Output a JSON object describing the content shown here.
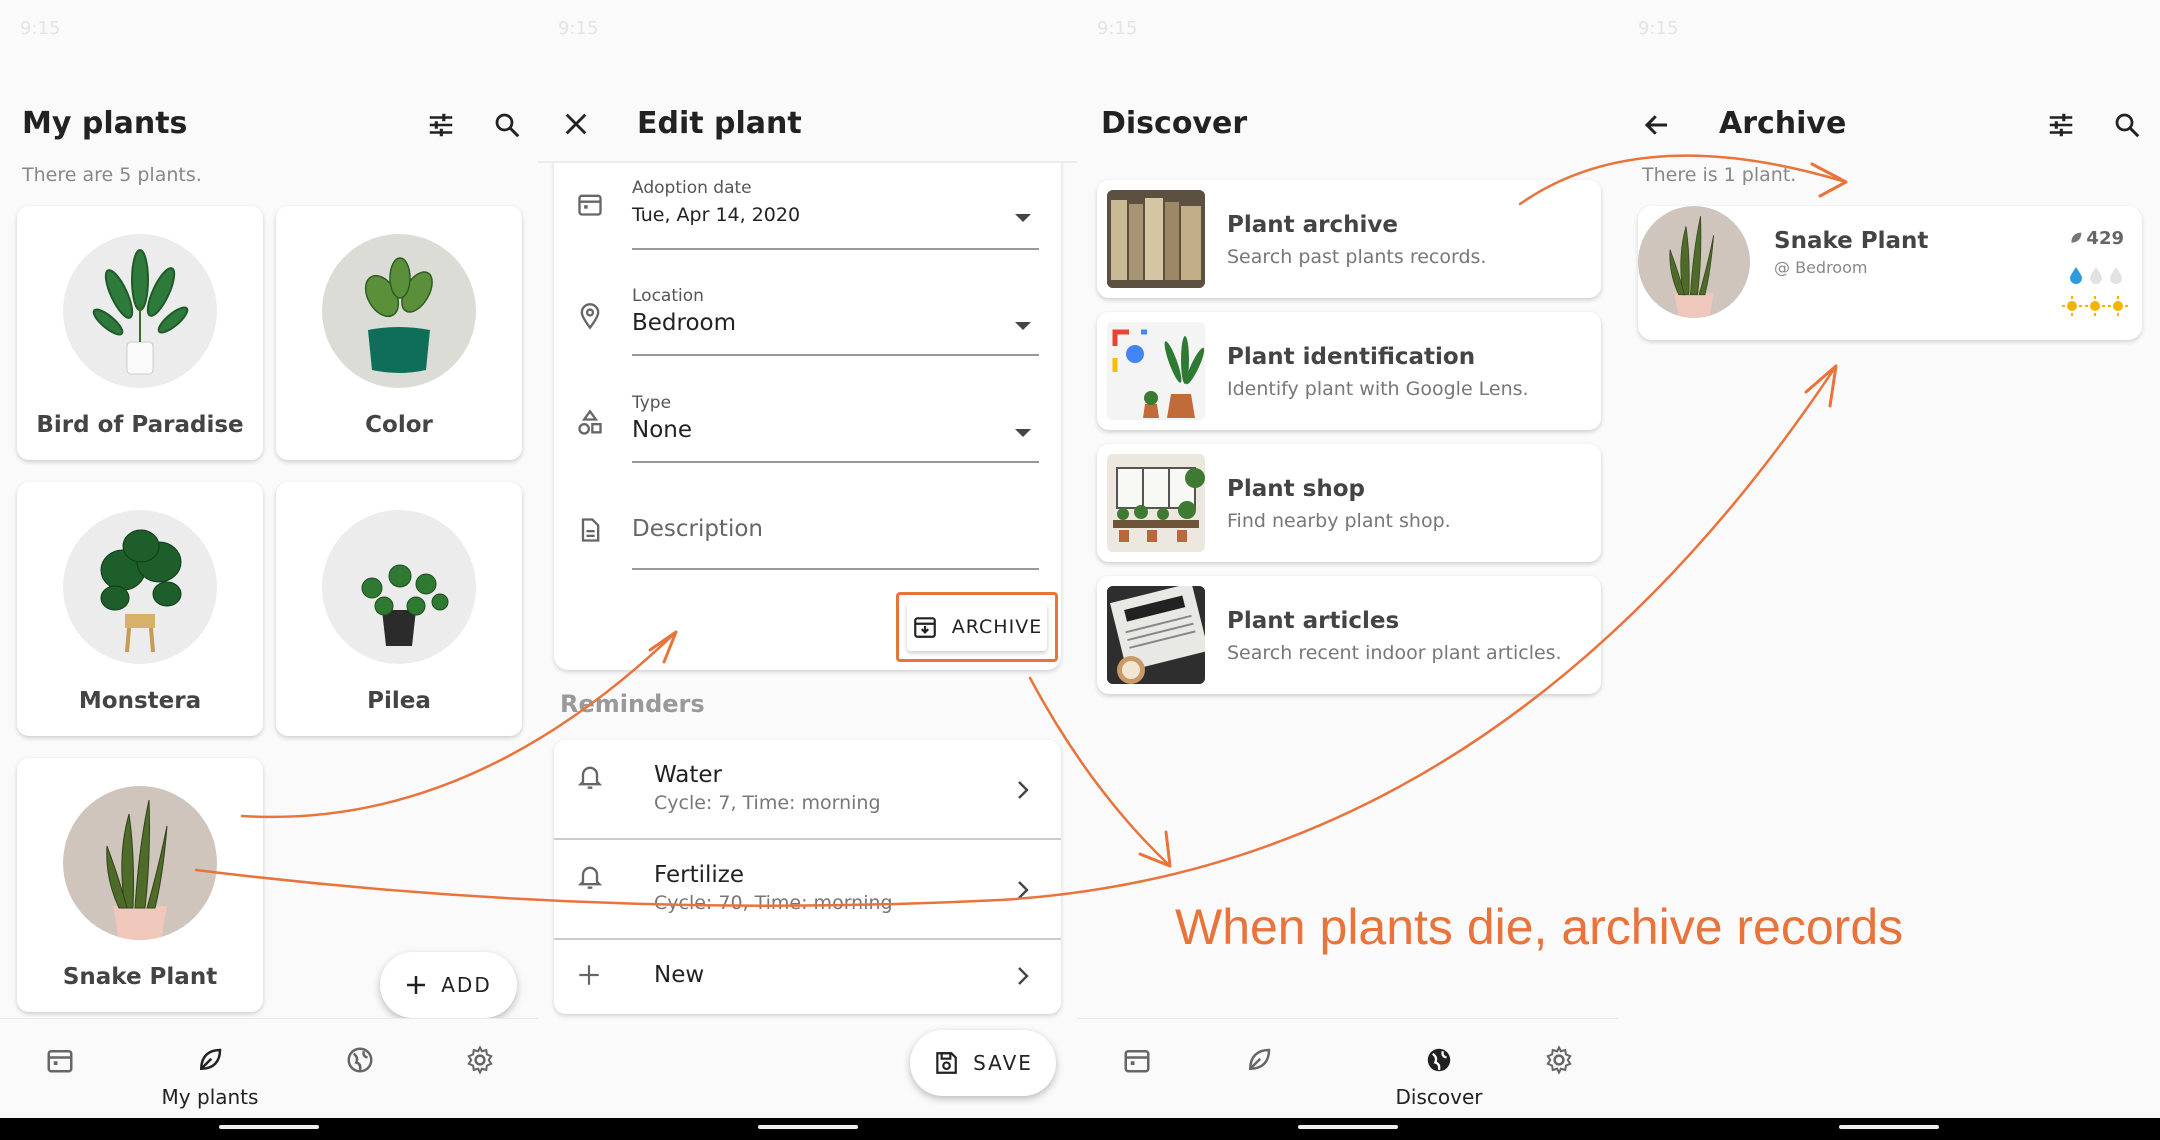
{
  "status_bar": {
    "time": "9:15"
  },
  "my_plants": {
    "title": "My plants",
    "subtitle": "There are 5 plants.",
    "plants": [
      {
        "name": "Bird of Paradise"
      },
      {
        "name": "Color"
      },
      {
        "name": "Monstera"
      },
      {
        "name": "Pilea"
      },
      {
        "name": "Snake Plant"
      }
    ],
    "add_label": "ADD",
    "nav": {
      "active_label": "My plants"
    }
  },
  "edit_plant": {
    "title": "Edit plant",
    "fields": {
      "adoption_label": "Adoption date",
      "adoption_value": "Tue, Apr 14, 2020",
      "location_label": "Location",
      "location_value": "Bedroom",
      "type_label": "Type",
      "type_value": "None",
      "description_placeholder": "Description"
    },
    "archive_label": "ARCHIVE",
    "reminders_label": "Reminders",
    "reminders": [
      {
        "title": "Water",
        "detail": "Cycle: 7, Time: morning"
      },
      {
        "title": "Fertilize",
        "detail": "Cycle: 70, Time: morning"
      },
      {
        "title": "New",
        "detail": ""
      }
    ],
    "save_label": "SAVE"
  },
  "discover": {
    "title": "Discover",
    "items": [
      {
        "title": "Plant archive",
        "subtitle": "Search past plants records."
      },
      {
        "title": "Plant identification",
        "subtitle": "Identify plant with Google Lens."
      },
      {
        "title": "Plant shop",
        "subtitle": "Find nearby plant shop."
      },
      {
        "title": "Plant articles",
        "subtitle": "Search recent indoor plant articles."
      }
    ],
    "nav": {
      "active_label": "Discover"
    }
  },
  "archive": {
    "title": "Archive",
    "subtitle": "There is 1 plant.",
    "item": {
      "name": "Snake Plant",
      "location": "@ Bedroom",
      "count": "429"
    }
  },
  "caption": "When plants die, archive records",
  "colors": {
    "accent": "#e9733a",
    "water_active": "#2f9ae0",
    "sun": "#f5b400"
  }
}
